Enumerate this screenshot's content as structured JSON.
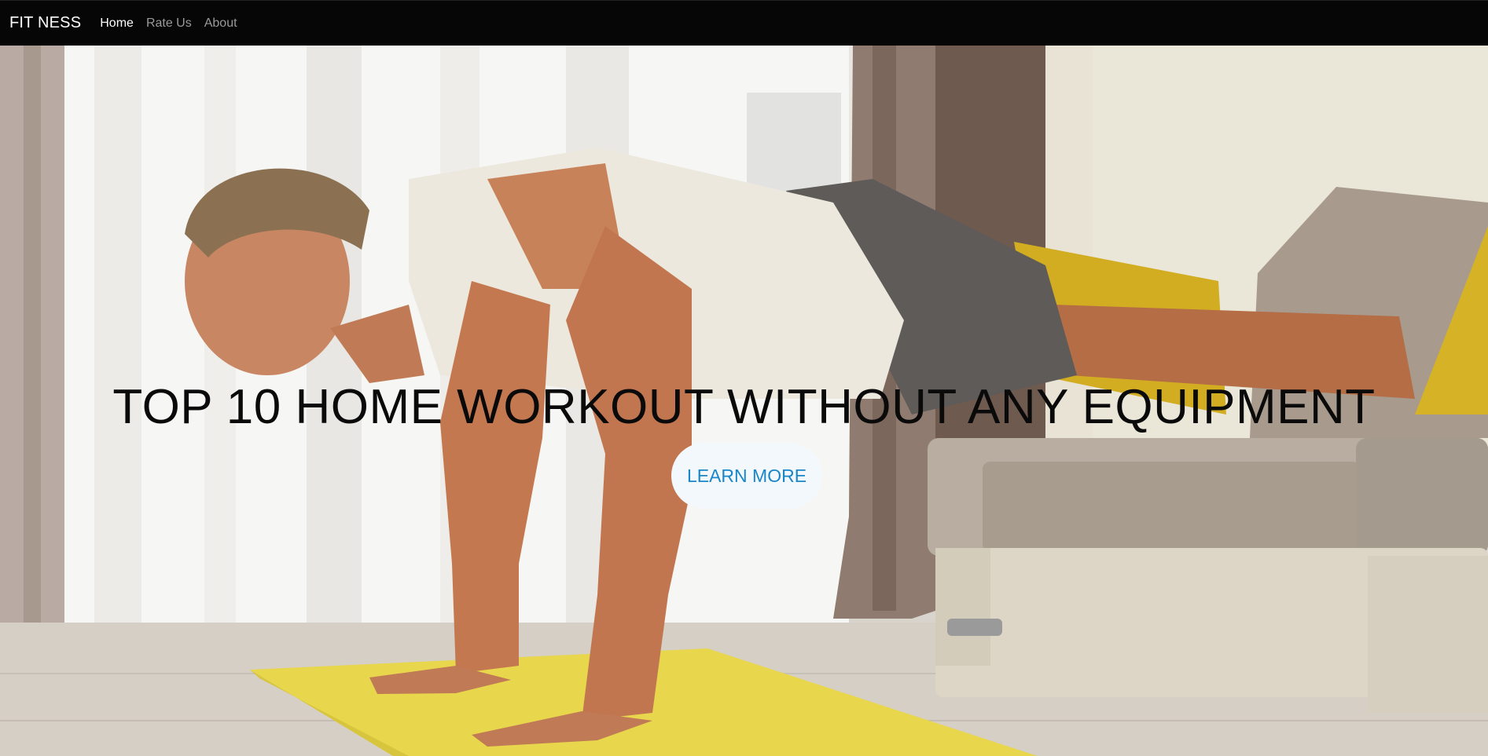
{
  "navbar": {
    "brand": "FIT NESS",
    "links": [
      {
        "label": "Home",
        "active": true
      },
      {
        "label": "Rate Us",
        "active": false
      },
      {
        "label": "About",
        "active": false
      }
    ]
  },
  "hero": {
    "title": "TOP 10 HOME WORKOUT WITHOUT ANY EQUIPMENT",
    "button_label": "LEARN MORE",
    "background_image": "man-doing-pushups-on-yellow-mat"
  },
  "colors": {
    "navbar_bg": "#060606",
    "button_text": "#1a86c8",
    "button_bg": "#f3f8fc",
    "title_text": "#0a0a0a"
  }
}
